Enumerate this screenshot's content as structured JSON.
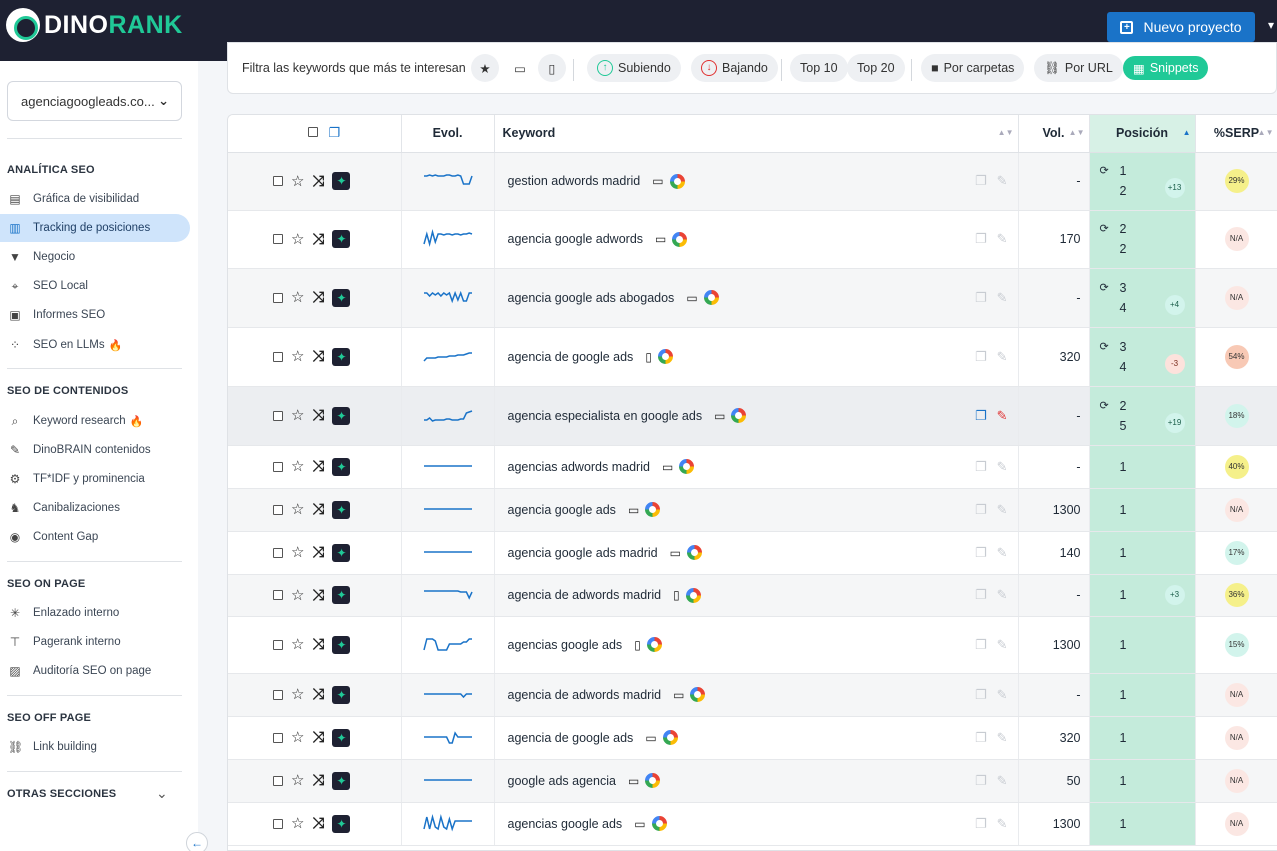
{
  "brand": {
    "name_part1": "DINO",
    "name_part2": "RANK",
    "accent": "#20c997",
    "topbar_bg": "#1e2132"
  },
  "header": {
    "new_project_label": "Nuevo proyecto",
    "new_project_color": "#1a73c8"
  },
  "sidebar": {
    "project_selector": "agenciagoogleads.co...",
    "sections": [
      {
        "title": "ANALÍTICA SEO",
        "items": [
          {
            "label": "Gráfica de visibilidad",
            "icon": "document-chart-icon"
          },
          {
            "label": "Tracking de posiciones",
            "icon": "bar-chart-icon",
            "active": true
          },
          {
            "label": "Negocio",
            "icon": "funnel-icon"
          },
          {
            "label": "SEO Local",
            "icon": "map-pin-icon"
          },
          {
            "label": "Informes SEO",
            "icon": "pdf-icon"
          },
          {
            "label": "SEO en LLMs",
            "icon": "llm-nodes-icon",
            "badge": "fire-icon"
          }
        ]
      },
      {
        "title": "SEO DE CONTENIDOS",
        "items": [
          {
            "label": "Keyword research",
            "icon": "keyword-search-icon",
            "badge": "fire-icon"
          },
          {
            "label": "DinoBRAIN contenidos",
            "icon": "pen-icon"
          },
          {
            "label": "TF*IDF y prominencia",
            "icon": "gear-icon"
          },
          {
            "label": "Canibalizaciones",
            "icon": "cannibal-icon"
          },
          {
            "label": "Content Gap",
            "icon": "eye-icon"
          }
        ]
      },
      {
        "title": "SEO ON PAGE",
        "items": [
          {
            "label": "Enlazado interno",
            "icon": "network-icon"
          },
          {
            "label": "Pagerank interno",
            "icon": "hierarchy-icon"
          },
          {
            "label": "Auditoría SEO on page",
            "icon": "audit-icon"
          }
        ]
      },
      {
        "title": "SEO OFF PAGE",
        "items": [
          {
            "label": "Link building",
            "icon": "link-icon"
          }
        ]
      },
      {
        "title": "OTRAS SECCIONES",
        "items": []
      }
    ]
  },
  "filters": {
    "label": "Filtra las keywords que más te interesan",
    "chips": [
      "Subiendo",
      "Bajando",
      "Top 10",
      "Top 20",
      "Por carpetas",
      "Por URL",
      "Snippets"
    ]
  },
  "table": {
    "columns": {
      "evol": "Evol.",
      "keyword": "Keyword",
      "vol": "Vol.",
      "pos": "Posición",
      "serp": "%SERP"
    },
    "rows": [
      {
        "keyword": "gestion adwords madrid",
        "device": "desktop",
        "vol": "-",
        "pos1": "1",
        "pos2": "2",
        "delta": "+13",
        "delta_dir": "up",
        "serp": "29%",
        "serp_color": "#f5f08a",
        "spark": [
          6,
          6,
          5,
          6,
          5,
          6,
          6,
          6,
          5,
          5,
          6,
          6,
          5,
          6,
          14,
          14,
          14,
          6
        ],
        "icon_line": true
      },
      {
        "keyword": "agencia google adwords",
        "device": "desktop",
        "vol": "170",
        "pos1": "2",
        "pos2": "2",
        "delta": "",
        "delta_dir": "",
        "serp": "N/A",
        "serp_color": "#fbe7e3",
        "spark": [
          16,
          6,
          16,
          4,
          14,
          6,
          6,
          7,
          6,
          6,
          7,
          6,
          6,
          7,
          6,
          6,
          5,
          6
        ],
        "icon_line": true
      },
      {
        "keyword": "agencia google ads abogados",
        "device": "desktop",
        "vol": "-",
        "pos1": "3",
        "pos2": "4",
        "delta": "+4",
        "delta_dir": "up",
        "serp": "N/A",
        "serp_color": "#fbe7e3",
        "spark": [
          6,
          6,
          9,
          6,
          8,
          6,
          9,
          6,
          8,
          6,
          14,
          6,
          13,
          6,
          14,
          14,
          6,
          6
        ],
        "icon_line": true
      },
      {
        "keyword": "agencia de google ads",
        "device": "mobile",
        "vol": "320",
        "pos1": "3",
        "pos2": "4",
        "delta": "-3",
        "delta_dir": "down",
        "serp": "54%",
        "serp_color": "#f8c9b5",
        "spark": [
          15,
          12,
          12,
          12,
          12,
          11,
          11,
          11,
          11,
          10,
          10,
          10,
          9,
          9,
          9,
          8,
          7,
          7
        ],
        "icon_line": true
      },
      {
        "keyword": "agencia especialista en google ads",
        "device": "desktop",
        "vol": "-",
        "pos1": "2",
        "pos2": "5",
        "delta": "+19",
        "delta_dir": "up",
        "serp": "18%",
        "serp_color": "#d2f4ec",
        "spark": [
          15,
          15,
          13,
          16,
          15,
          15,
          15,
          15,
          14,
          14,
          15,
          15,
          15,
          14,
          14,
          8,
          7,
          6
        ],
        "icon_line": true,
        "hot": true
      },
      {
        "keyword": "agencias adwords madrid",
        "device": "desktop",
        "vol": "-",
        "pos1": "1",
        "pos2": "",
        "delta": "",
        "delta_dir": "",
        "serp": "40%",
        "serp_color": "#f5f08a",
        "spark": [
          10,
          10,
          10,
          10,
          10,
          10,
          10,
          10,
          10,
          10,
          10,
          10,
          10,
          10,
          10,
          10,
          10,
          10
        ]
      },
      {
        "keyword": "agencia google ads",
        "device": "desktop",
        "vol": "1300",
        "pos1": "1",
        "pos2": "",
        "delta": "",
        "delta_dir": "",
        "serp": "N/A",
        "serp_color": "#fbe7e3",
        "spark": [
          10,
          10,
          10,
          10,
          10,
          10,
          10,
          10,
          10,
          10,
          10,
          10,
          10,
          10,
          10,
          10,
          10,
          10
        ]
      },
      {
        "keyword": "agencia google ads madrid",
        "device": "desktop",
        "vol": "140",
        "pos1": "1",
        "pos2": "",
        "delta": "",
        "delta_dir": "",
        "serp": "17%",
        "serp_color": "#d2f4ec",
        "spark": [
          10,
          10,
          10,
          10,
          10,
          10,
          10,
          10,
          10,
          10,
          10,
          10,
          10,
          10,
          10,
          10,
          10,
          10
        ]
      },
      {
        "keyword": "agencia de adwords madrid",
        "device": "mobile",
        "vol": "-",
        "pos1": "1",
        "pos2": "",
        "delta": "+3",
        "delta_dir": "up",
        "serp": "36%",
        "serp_color": "#f5f08a",
        "spark": [
          7,
          7,
          7,
          7,
          7,
          7,
          7,
          7,
          7,
          7,
          7,
          7,
          7,
          8,
          8,
          8,
          14,
          8
        ],
        "delta_mid": true
      },
      {
        "keyword": "agencias google ads",
        "device": "mobile",
        "vol": "1300",
        "pos1": "1",
        "pos2": "",
        "delta": "",
        "delta_dir": "",
        "serp": "15%",
        "serp_color": "#d2f4ec",
        "spark": [
          16,
          5,
          5,
          5,
          7,
          16,
          16,
          16,
          16,
          10,
          10,
          10,
          10,
          10,
          8,
          8,
          5,
          5
        ]
      },
      {
        "keyword": "agencia de adwords madrid",
        "device": "desktop",
        "vol": "-",
        "pos1": "1",
        "pos2": "",
        "delta": "",
        "delta_dir": "",
        "serp": "N/A",
        "serp_color": "#fbe7e3",
        "spark": [
          10,
          10,
          10,
          10,
          10,
          10,
          10,
          10,
          10,
          10,
          10,
          10,
          10,
          10,
          13,
          10,
          10,
          10
        ]
      },
      {
        "keyword": "agencia de google ads",
        "device": "desktop",
        "vol": "320",
        "pos1": "1",
        "pos2": "",
        "delta": "",
        "delta_dir": "",
        "serp": "N/A",
        "serp_color": "#fbe7e3",
        "spark": [
          10,
          10,
          10,
          10,
          10,
          10,
          10,
          10,
          10,
          16,
          16,
          6,
          10,
          10,
          10,
          10,
          10,
          10
        ]
      },
      {
        "keyword": "google ads agencia",
        "device": "desktop",
        "vol": "50",
        "pos1": "1",
        "pos2": "",
        "delta": "",
        "delta_dir": "",
        "serp": "N/A",
        "serp_color": "#fbe7e3",
        "spark": [
          10,
          10,
          10,
          10,
          10,
          10,
          10,
          10,
          10,
          10,
          10,
          10,
          10,
          10,
          10,
          10,
          10,
          10
        ]
      },
      {
        "keyword": "agencias google ads",
        "device": "desktop",
        "vol": "1300",
        "pos1": "1",
        "pos2": "",
        "delta": "",
        "delta_dir": "",
        "serp": "N/A",
        "serp_color": "#fbe7e3",
        "spark": [
          16,
          4,
          16,
          4,
          14,
          16,
          4,
          14,
          16,
          6,
          16,
          8,
          8,
          8,
          8,
          8,
          8,
          8
        ]
      }
    ]
  }
}
